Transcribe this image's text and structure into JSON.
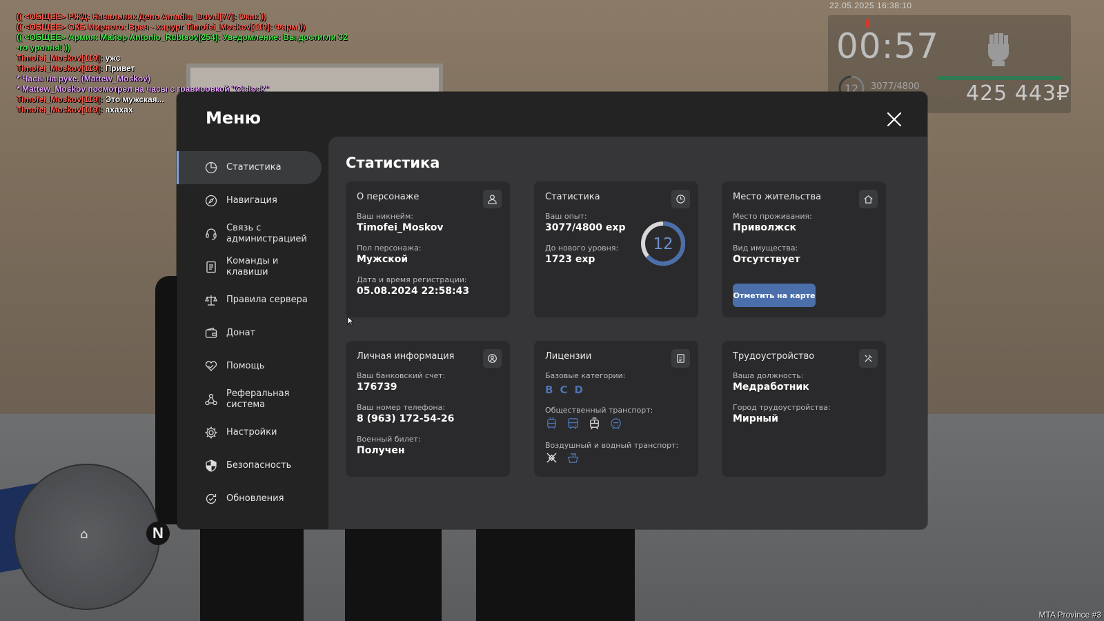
{
  "chat": [
    {
      "parts": [
        {
          "text": "(( <ОБЩЕЕ> РЖД: Начальник Депо Amadiu_Duval[77]: Окак ))",
          "color": "red"
        }
      ]
    },
    {
      "parts": [
        {
          "text": "(( <ОБЩЕЕ> ОКБ Мирного: Врач - хирург Timofei_Moskov[119]: Фарм ))",
          "color": "red"
        }
      ]
    },
    {
      "parts": [
        {
          "text": "(( <ОБЩЕЕ> Армия: Майор Antonio_Rubtsov[254]: Уведомление: Вы достигли 32",
          "color": "green"
        }
      ]
    },
    {
      "parts": [
        {
          "text": "-го уровня! ))",
          "color": "green"
        }
      ]
    },
    {
      "parts": [
        {
          "text": "Timofei_Moskov[119]: ",
          "color": "red"
        },
        {
          "text": "ужс",
          "color": "white"
        }
      ]
    },
    {
      "parts": [
        {
          "text": "Timofei_Moskov[119]: ",
          "color": "red"
        },
        {
          "text": "Привет",
          "color": "white"
        }
      ]
    },
    {
      "parts": [
        {
          "text": "* Часы на руке. (Mattew_Moskov)",
          "color": "pink"
        }
      ]
    },
    {
      "parts": [
        {
          "text": "* Mattew_Moskov посмотрел на часы с гравировкой \"O'clock\"",
          "color": "pink"
        }
      ]
    },
    {
      "parts": [
        {
          "text": "Timofei_Moskov[119]: ",
          "color": "red"
        },
        {
          "text": "Это мужская...",
          "color": "white"
        }
      ]
    },
    {
      "parts": [
        {
          "text": "Timofei_Moskov[119]: ",
          "color": "red"
        },
        {
          "text": "ахахах",
          "color": "white"
        }
      ]
    }
  ],
  "hud": {
    "datetime": "22.05.2025 16:38:10",
    "clock": "00:57",
    "level": "12",
    "exp": "3077/4800",
    "money": "425 443₽",
    "bar_fraction": 1.0
  },
  "watermark": "MTA Province #3",
  "radar": {
    "north": "N"
  },
  "menu": {
    "title": "Меню",
    "nav": [
      {
        "label": "Статистика",
        "icon": "pie-chart-icon",
        "active": true
      },
      {
        "label": "Навигация",
        "icon": "compass-icon"
      },
      {
        "label": "Связь с администрацией",
        "icon": "headset-icon"
      },
      {
        "label": "Команды и клавиши",
        "icon": "document-list-icon"
      },
      {
        "label": "Правила сервера",
        "icon": "scales-icon"
      },
      {
        "label": "Донат",
        "icon": "wallet-icon"
      },
      {
        "label": "Помощь",
        "icon": "handshake-heart-icon"
      },
      {
        "label": "Реферальная система",
        "icon": "referral-nodes-icon"
      },
      {
        "label": "Настройки",
        "icon": "gear-icon"
      },
      {
        "label": "Безопасность",
        "icon": "shield-icon"
      },
      {
        "label": "Обновления",
        "icon": "refresh-check-icon"
      }
    ],
    "page_title": "Статистика",
    "cards": {
      "character": {
        "title": "О персонаже",
        "nickname_label": "Ваш никнейм:",
        "nickname": "Timofei_Moskov",
        "gender_label": "Пол персонажа:",
        "gender": "Мужской",
        "reg_label": "Дата и время регистрации:",
        "reg": "05.08.2024 22:58:43"
      },
      "stats": {
        "title": "Статистика",
        "exp_label": "Ваш опыт:",
        "exp": "3077/4800 exp",
        "next_label": "До нового уровня:",
        "next": "1723 exp",
        "level": "12",
        "progress_fraction": 0.641
      },
      "residence": {
        "title": "Место жительства",
        "place_label": "Место проживания:",
        "place": "Приволжск",
        "property_label": "Вид имущества:",
        "property": "Отсутствует",
        "map_button": "Отметить на карте"
      },
      "personal": {
        "title": "Личная информация",
        "bank_label": "Ваш банковский счет:",
        "bank": "176739",
        "phone_label": "Ваш номер телефона:",
        "phone": "8 (963) 172-54-26",
        "military_label": "Военный билет:",
        "military": "Получен"
      },
      "licenses": {
        "title": "Лицензии",
        "base_label": "Базовые категории:",
        "base": [
          "B",
          "C",
          "D"
        ],
        "public_label": "Общественный транспорт:",
        "public_icons": [
          "trolleybus-icon",
          "bus-icon",
          "tram-icon",
          "metro-icon"
        ],
        "air_label": "Воздушный и водный транспорт:",
        "air_icons": [
          "airplane-icon",
          "boat-icon"
        ]
      },
      "employment": {
        "title": "Трудоустройство",
        "position_label": "Ваша должность:",
        "position": "Медработник",
        "city_label": "Город трудоустройства:",
        "city": "Мирный"
      }
    }
  },
  "colors": {
    "accent": "#4b6fab",
    "license_blue": "#4d74b0",
    "window": "#232324",
    "content": "#363638",
    "card": "#2a2a2c"
  }
}
